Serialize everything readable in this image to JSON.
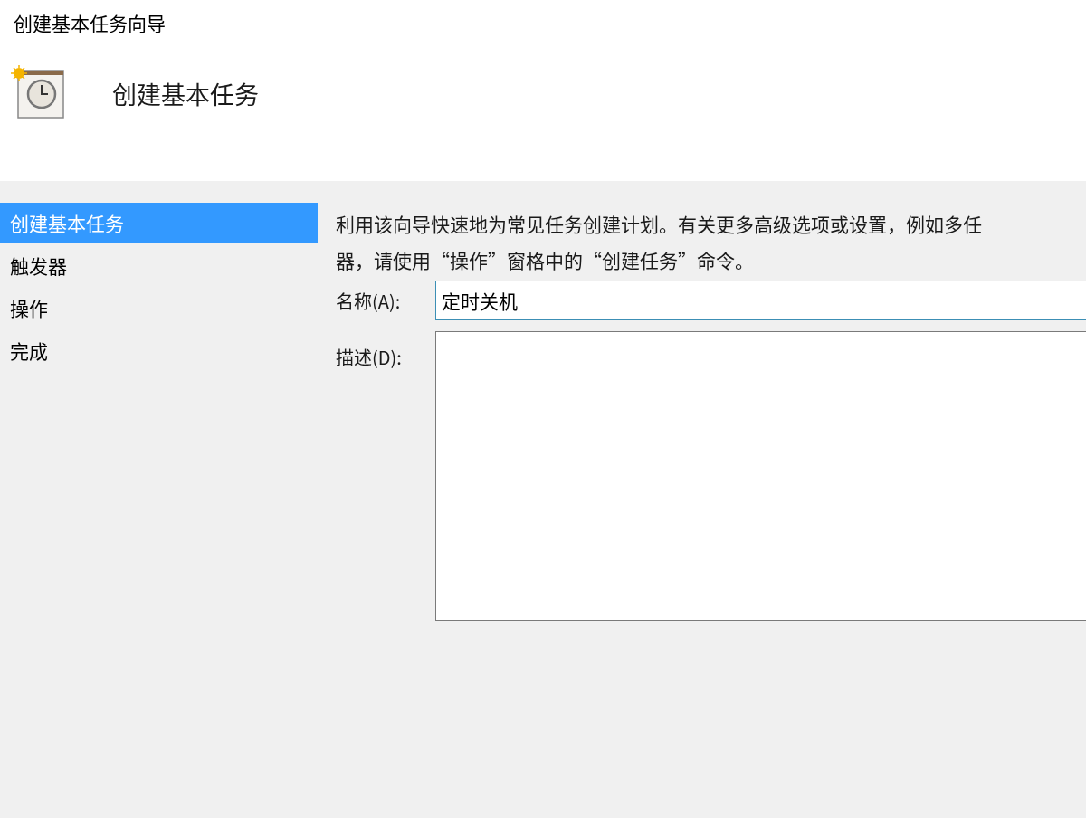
{
  "window": {
    "title": "创建基本任务向导"
  },
  "header": {
    "title": "创建基本任务"
  },
  "steps": [
    {
      "label": "创建基本任务",
      "selected": true
    },
    {
      "label": "触发器",
      "selected": false
    },
    {
      "label": "操作",
      "selected": false
    },
    {
      "label": "完成",
      "selected": false
    }
  ],
  "intro_lines": [
    "利用该向导快速地为常见任务创建计划。有关更多高级选项或设置，例如多任",
    "器，请使用“操作”窗格中的“创建任务”命令。"
  ],
  "name_field": {
    "label": "名称(A):",
    "value": "定时关机",
    "focused": true
  },
  "description_field": {
    "label": "描述(D):",
    "focused": false
  }
}
